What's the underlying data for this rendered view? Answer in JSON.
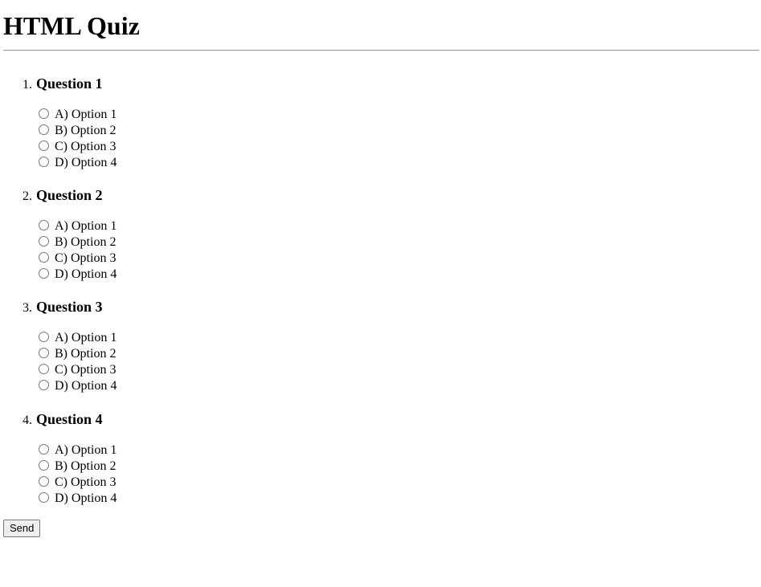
{
  "page": {
    "title": "HTML Quiz"
  },
  "questions": [
    {
      "number": "1.",
      "title": "Question 1",
      "options": [
        "A) Option 1",
        "B) Option 2",
        "C) Option 3",
        "D) Option 4"
      ]
    },
    {
      "number": "2.",
      "title": "Question 2",
      "options": [
        "A) Option 1",
        "B) Option 2",
        "C) Option 3",
        "D) Option 4"
      ]
    },
    {
      "number": "3.",
      "title": "Question 3",
      "options": [
        "A) Option 1",
        "B) Option 2",
        "C) Option 3",
        "D) Option 4"
      ]
    },
    {
      "number": "4.",
      "title": "Question 4",
      "options": [
        "A) Option 1",
        "B) Option 2",
        "C) Option 3",
        "D) Option 4"
      ]
    }
  ],
  "form": {
    "submit_label": "Send"
  }
}
